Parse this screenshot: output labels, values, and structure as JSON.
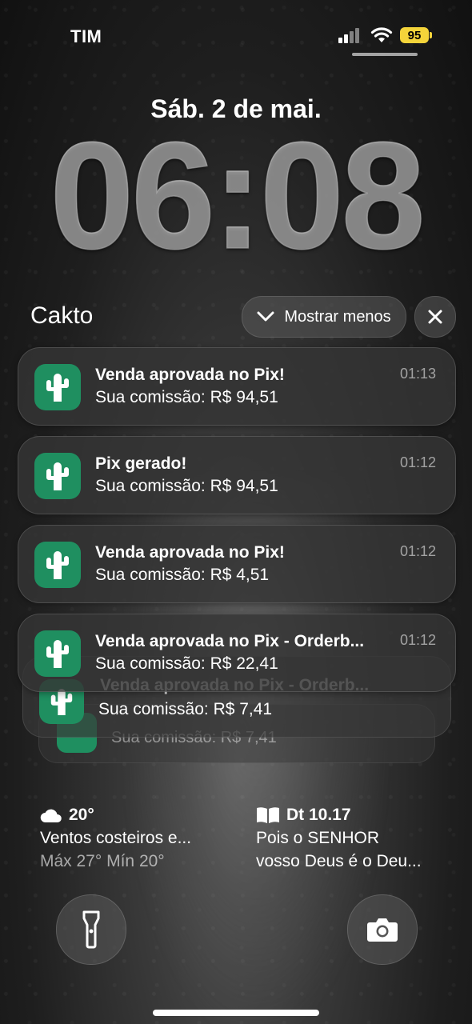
{
  "status_bar": {
    "carrier": "TIM",
    "battery": "95"
  },
  "lock": {
    "date": "Sáb. 2 de mai.",
    "time": "06:08"
  },
  "notification_group": {
    "app_name": "Cakto",
    "show_less_label": "Mostrar menos",
    "notifications": [
      {
        "title": "Venda aprovada no Pix!",
        "body": "Sua comissão: R$ 94,51",
        "time": "01:13"
      },
      {
        "title": "Pix gerado!",
        "body": "Sua comissão: R$ 94,51",
        "time": "01:12"
      },
      {
        "title": "Venda aprovada no Pix!",
        "body": "Sua comissão: R$ 4,51",
        "time": "01:12"
      },
      {
        "title": "Venda aprovada no Pix - Orderb...",
        "body": "Sua comissão: R$ 22,41",
        "time": "01:12"
      }
    ],
    "stacked": [
      {
        "title": "Venda aprovada no Pix - Orderb...",
        "body": "Sua comissão: R$ 7,41"
      },
      {
        "body": "Sua comissão: R$ 7,41"
      }
    ]
  },
  "widgets": {
    "weather": {
      "icon": "cloud-icon",
      "temp": "20°",
      "description": "Ventos costeiros e...",
      "range": "Máx 27° Mín 20°"
    },
    "bible": {
      "icon": "book-icon",
      "reference": "Dt 10.17",
      "line1": "Pois o SENHOR",
      "line2": "vosso Deus é o Deu..."
    }
  },
  "actions": {
    "flashlight_icon": "flashlight-icon",
    "camera_icon": "camera-icon"
  },
  "colors": {
    "app_icon_green": "#1f8f60",
    "battery_yellow": "#f4d43a"
  }
}
